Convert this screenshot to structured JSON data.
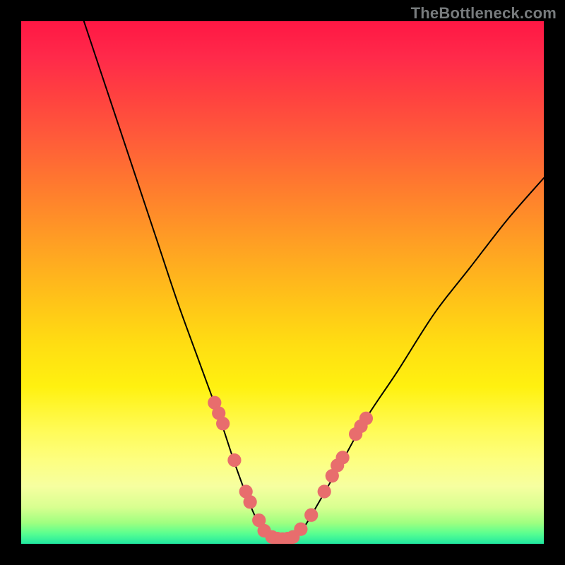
{
  "watermark": "TheBottleneck.com",
  "chart_data": {
    "type": "line",
    "title": "",
    "xlabel": "",
    "ylabel": "",
    "xlim": [
      0,
      100
    ],
    "ylim": [
      0,
      100
    ],
    "curve": {
      "name": "bottleneck-curve",
      "points": [
        {
          "x": 12,
          "y": 100
        },
        {
          "x": 17,
          "y": 85
        },
        {
          "x": 22,
          "y": 70
        },
        {
          "x": 26,
          "y": 58
        },
        {
          "x": 30,
          "y": 46
        },
        {
          "x": 34,
          "y": 35
        },
        {
          "x": 38,
          "y": 24
        },
        {
          "x": 41,
          "y": 15
        },
        {
          "x": 44,
          "y": 7
        },
        {
          "x": 46,
          "y": 3
        },
        {
          "x": 48,
          "y": 1
        },
        {
          "x": 50,
          "y": 0.8
        },
        {
          "x": 52,
          "y": 1
        },
        {
          "x": 54,
          "y": 3
        },
        {
          "x": 57,
          "y": 8
        },
        {
          "x": 61,
          "y": 15
        },
        {
          "x": 66,
          "y": 24
        },
        {
          "x": 72,
          "y": 33
        },
        {
          "x": 79,
          "y": 44
        },
        {
          "x": 86,
          "y": 53
        },
        {
          "x": 93,
          "y": 62
        },
        {
          "x": 100,
          "y": 70
        }
      ]
    },
    "markers": {
      "name": "highlight-dots",
      "color": "#e86d6d",
      "radius": 1.3,
      "points": [
        {
          "x": 37.0,
          "y": 27
        },
        {
          "x": 37.8,
          "y": 25
        },
        {
          "x": 38.6,
          "y": 23
        },
        {
          "x": 40.8,
          "y": 16
        },
        {
          "x": 43.0,
          "y": 10
        },
        {
          "x": 43.8,
          "y": 8
        },
        {
          "x": 45.5,
          "y": 4.5
        },
        {
          "x": 46.5,
          "y": 2.5
        },
        {
          "x": 48.0,
          "y": 1.3
        },
        {
          "x": 49.0,
          "y": 1.0
        },
        {
          "x": 50.0,
          "y": 0.9
        },
        {
          "x": 51.0,
          "y": 1.0
        },
        {
          "x": 52.0,
          "y": 1.3
        },
        {
          "x": 53.5,
          "y": 2.8
        },
        {
          "x": 55.5,
          "y": 5.5
        },
        {
          "x": 58.0,
          "y": 10
        },
        {
          "x": 59.5,
          "y": 13
        },
        {
          "x": 60.5,
          "y": 15
        },
        {
          "x": 61.5,
          "y": 16.5
        },
        {
          "x": 64.0,
          "y": 21
        },
        {
          "x": 65.0,
          "y": 22.5
        },
        {
          "x": 66.0,
          "y": 24
        }
      ]
    }
  }
}
